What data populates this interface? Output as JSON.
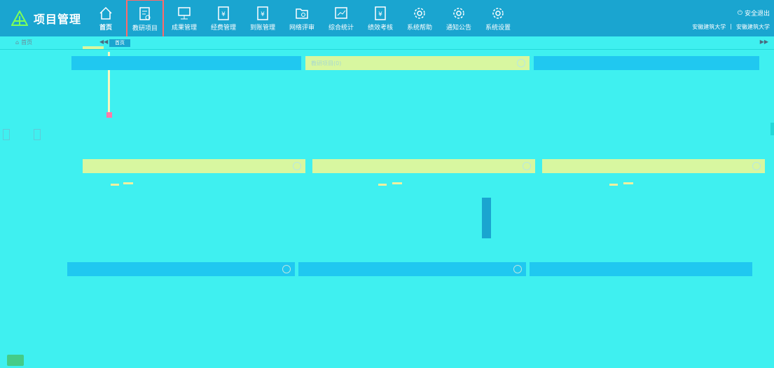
{
  "app": {
    "title": "项目管理"
  },
  "nav": [
    {
      "label": "首页",
      "icon": "home-icon"
    },
    {
      "label": "教研项目",
      "icon": "project-doc-icon"
    },
    {
      "label": "成果管理",
      "icon": "presentation-icon"
    },
    {
      "label": "经费管理",
      "icon": "yuan-doc-icon"
    },
    {
      "label": "到账管理",
      "icon": "yuan-doc-icon"
    },
    {
      "label": "网络评审",
      "icon": "folder-review-icon"
    },
    {
      "label": "综合统计",
      "icon": "chart-icon"
    },
    {
      "label": "绩效考核",
      "icon": "yuan-doc-icon"
    },
    {
      "label": "系统帮助",
      "icon": "gear-icon"
    },
    {
      "label": "通知公告",
      "icon": "gear-icon"
    },
    {
      "label": "系统设置",
      "icon": "gear-icon"
    }
  ],
  "header": {
    "logout": "安全退出",
    "org": "安徽建筑大学",
    "user": "安徽建筑大学",
    "separator": "|"
  },
  "tabs": {
    "home": "首页",
    "active": "首页",
    "prev": "◀◀",
    "next": "▶▶"
  },
  "panels": {
    "teaching_projects": "教研项目(0)"
  },
  "colors": {
    "header": "#1aa5d0",
    "background": "#3ff0f0",
    "highlight": "#ff6a6a"
  }
}
